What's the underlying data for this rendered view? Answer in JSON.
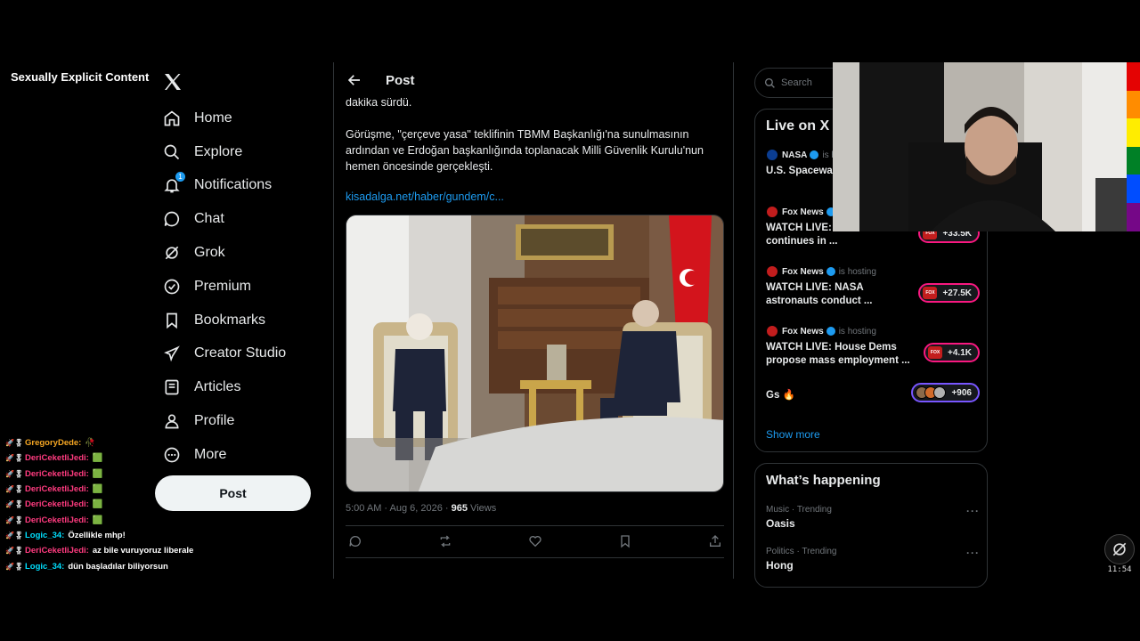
{
  "overlay": {
    "warning": "Sexually Explicit Content"
  },
  "nav": {
    "items": [
      {
        "label": "Home",
        "icon": "home-icon"
      },
      {
        "label": "Explore",
        "icon": "search-icon"
      },
      {
        "label": "Notifications",
        "icon": "bell-icon",
        "badge": "1"
      },
      {
        "label": "Chat",
        "icon": "chat-icon"
      },
      {
        "label": "Grok",
        "icon": "grok-icon"
      },
      {
        "label": "Premium",
        "icon": "premium-icon"
      },
      {
        "label": "Bookmarks",
        "icon": "bookmark-icon"
      },
      {
        "label": "Creator Studio",
        "icon": "rocket-icon"
      },
      {
        "label": "Articles",
        "icon": "article-icon"
      },
      {
        "label": "Profile",
        "icon": "profile-icon"
      },
      {
        "label": "More",
        "icon": "more-icon"
      }
    ],
    "post_button": "Post"
  },
  "chat": [
    {
      "user": "GregoryDede:",
      "msg": "🥀",
      "color": "#f5a623"
    },
    {
      "user": "DeriCeketliJedi:",
      "msg": "🟩",
      "color": "#ff3b7f"
    },
    {
      "user": "DeriCeketliJedi:",
      "msg": "🟩",
      "color": "#ff3b7f"
    },
    {
      "user": "DeriCeketliJedi:",
      "msg": "🟩",
      "color": "#ff3b7f"
    },
    {
      "user": "DeriCeketliJedi:",
      "msg": "🟩",
      "color": "#ff3b7f"
    },
    {
      "user": "DeriCeketliJedi:",
      "msg": "🟩",
      "color": "#ff3b7f"
    },
    {
      "user": "Logic_34:",
      "msg": "Özellikle mhp!",
      "color": "#00e0ff"
    },
    {
      "user": "DeriCeketliJedi:",
      "msg": "az bile vuruyoruz liberale",
      "color": "#ff3b7f"
    },
    {
      "user": "Logic_34:",
      "msg": "dün başladılar biliyorsun",
      "color": "#00e0ff"
    }
  ],
  "post": {
    "header_title": "Post",
    "text_top": "dakika sürdü.",
    "text_body": "Görüşme, \"çerçeve yasa\" teklifinin TBMM Başkanlığı'na sunulmasının ardından ve Erdoğan başkanlığında toplanacak Milli Güvenlik Kurulu'nun hemen öncesinde gerçekleşti.",
    "link": "kisadalga.net/haber/gundem/c...",
    "timestamp": "5:00 AM · Aug 6, 2026 · ",
    "views_count": "965",
    "views_label": " Views"
  },
  "sidebar": {
    "search_placeholder": "Search",
    "live_title": "Live on X",
    "live": [
      {
        "source": "NASA",
        "hosting": "is h",
        "title": "U.S. Spacewal"
      },
      {
        "source": "Fox News",
        "hosting": "",
        "title": "WATCH LIVE: L... murder trial continues in ...",
        "count": "+33.5K"
      },
      {
        "source": "Fox News",
        "hosting": "is hosting",
        "title": "WATCH LIVE: NASA astronauts conduct ...",
        "count": "+27.5K"
      },
      {
        "source": "Fox News",
        "hosting": "is hosting",
        "title": "WATCH LIVE: House Dems propose mass employment ...",
        "count": "+4.1K"
      },
      {
        "source": "",
        "hosting": "",
        "title": "Gs 🔥",
        "count": "+906"
      }
    ],
    "show_more": "Show more",
    "happening_title": "What’s happening",
    "trends": [
      {
        "category": "Music · Trending",
        "name": "Oasis"
      },
      {
        "category": "Politics · Trending",
        "name": "Hong"
      }
    ]
  },
  "widget": {
    "time": "11:54"
  }
}
